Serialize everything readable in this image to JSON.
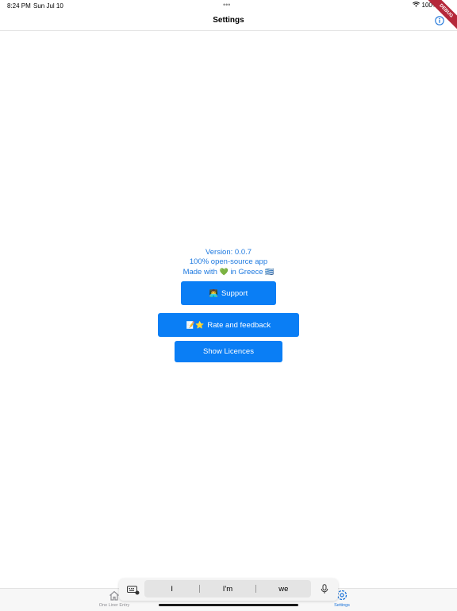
{
  "status_bar": {
    "time": "8:24 PM",
    "date": "Sun Jul 10",
    "battery": "100%",
    "debug_banner": "DEBUG"
  },
  "nav": {
    "title": "Settings",
    "info_icon": "info-circle-icon"
  },
  "content": {
    "version": "Version: 0.0.7",
    "open_source": "100% open-source app",
    "made_with_prefix": "Made with",
    "heart_emoji": "💚",
    "in_country": "in Greece",
    "flag_emoji": "🇬🇷",
    "support_emoji": "👨‍💻",
    "support_label": "Support",
    "rate_emoji": "📝⭐️",
    "rate_label": "Rate and feedback",
    "licences_label": "Show Licences"
  },
  "tabs": [
    {
      "label": "One Liner Entry",
      "icon": "home-icon",
      "active": false
    },
    {
      "label": "Settings",
      "icon": "settings-icon",
      "active": true
    }
  ],
  "keyboard": {
    "suggestions": [
      "I",
      "I'm",
      "we"
    ],
    "keyboard_icon": "keyboard-icon",
    "mic_icon": "microphone-icon"
  },
  "colors": {
    "accent": "#0a7ef5",
    "text_accent": "#1f7ae0",
    "tab_active": "#1a73d9",
    "tab_inactive": "#8e8e93"
  }
}
